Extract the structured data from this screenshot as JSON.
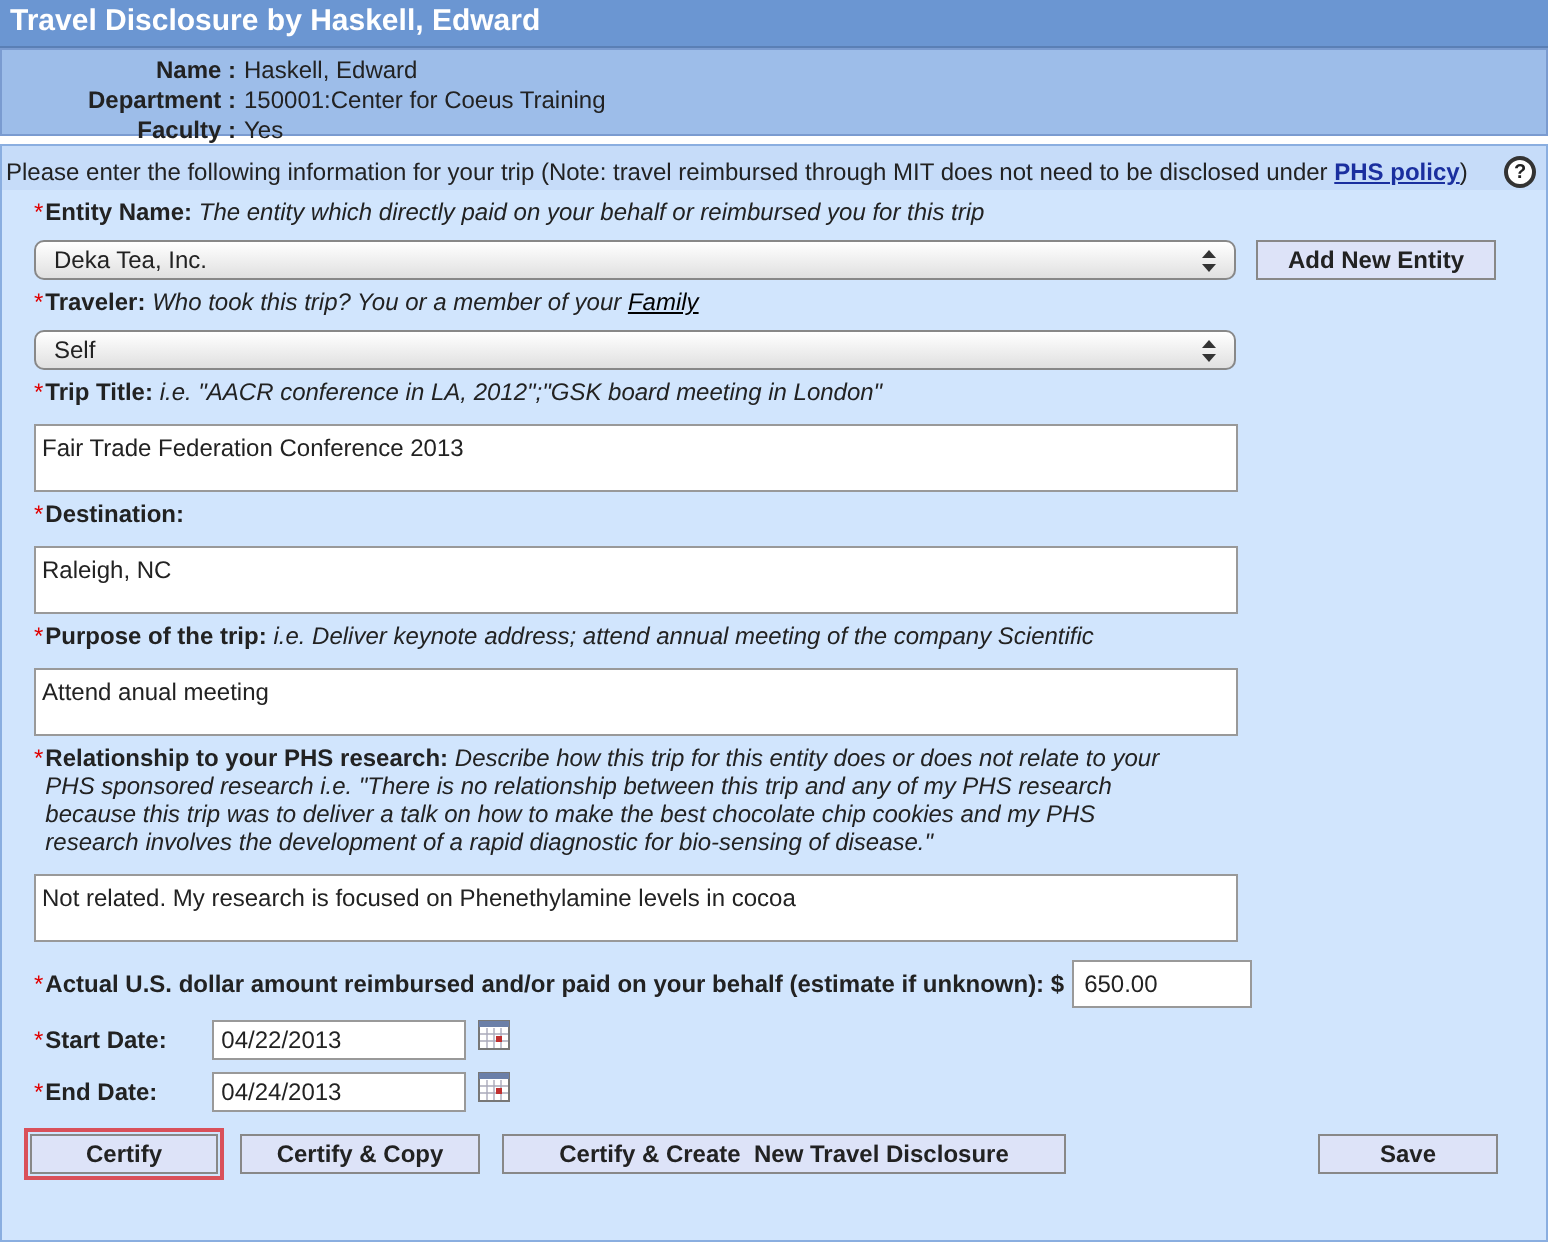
{
  "header": {
    "title": "Travel Disclosure by Haskell, Edward"
  },
  "info": [
    {
      "label": "Name :",
      "value": "Haskell, Edward"
    },
    {
      "label": "Department :",
      "value": "150001:Center for Coeus Training"
    },
    {
      "label": "Faculty :",
      "value": "Yes"
    }
  ],
  "intro": {
    "text": "Please enter the following information for your trip (Note: travel reimbursed through MIT does not need to be disclosed under ",
    "link": "PHS policy",
    "after": ")",
    "help": "?"
  },
  "fields": [
    {
      "kind": "select",
      "mark": "*",
      "label": "Entity Name:",
      "hint": "The entity which directly paid on your behalf or reimbursed you for this trip",
      "value": "Deka Tea, Inc.",
      "button": "Add New Entity"
    },
    {
      "kind": "select",
      "mark": "*",
      "label": "Traveler:",
      "hint": "Who took this trip? You or a member of your ",
      "hint_link": "Family",
      "value": "Self"
    },
    {
      "kind": "text",
      "mark": "*",
      "label": "Trip Title:",
      "hint": "i.e. \"AACR conference in LA, 2012\";\"GSK board meeting in London\"",
      "value": "Fair Trade Federation Conference 2013"
    },
    {
      "kind": "text",
      "mark": "*",
      "label": "Destination:",
      "value": "Raleigh, NC"
    },
    {
      "kind": "text",
      "mark": "*",
      "label": "Purpose of the trip:",
      "hint": "i.e. Deliver keynote address; attend annual meeting of the company Scientific",
      "value": "Attend anual meeting"
    },
    {
      "kind": "text",
      "mark": "*",
      "label": "Relationship to your PHS research:",
      "hint": "Describe how this trip for this entity does or does not relate to your PHS sponsored research i.e. \"There is no relationship between this trip and any of my PHS research because this trip was to deliver a talk on how to make the best chocolate chip cookies and my PHS research involves the development of a rapid diagnostic for bio-sensing of disease.\"",
      "value": "Not related. My research is focused on Phenethylamine levels in cocoa"
    }
  ],
  "amount": {
    "mark": "*",
    "label": "Actual U.S. dollar amount reimbursed and/or paid on your behalf (estimate if unknown): $",
    "value": "650.00"
  },
  "dates": [
    {
      "mark": "*",
      "label": "Start Date:",
      "value": "04/22/2013"
    },
    {
      "mark": "*",
      "label": "End Date:",
      "value": "04/24/2013"
    }
  ],
  "buttons": [
    {
      "label": "Certify",
      "highlighted": true
    },
    {
      "label": "Certify & Copy",
      "highlighted": false
    },
    {
      "label": "Certify & Create  New Travel Disclosure",
      "highlighted": false
    }
  ],
  "save_button": "Save"
}
